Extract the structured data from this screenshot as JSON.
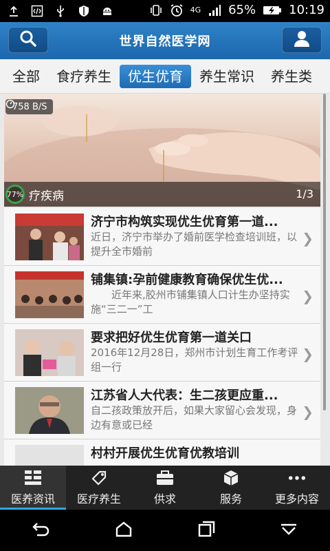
{
  "status_bar": {
    "battery_percent": "65%",
    "time": "10:19",
    "network": "4G"
  },
  "app": {
    "title": "世界自然医学网"
  },
  "tabs": [
    {
      "label": "全部"
    },
    {
      "label": "食疗养生"
    },
    {
      "label": "优生优育",
      "active": true
    },
    {
      "label": "养生常识"
    },
    {
      "label": "养生类"
    }
  ],
  "banner": {
    "speed": "758 B/S",
    "title": "疗疾病",
    "page": "1/3",
    "progress_label": "77%"
  },
  "articles": [
    {
      "title": "济宁市构筑实现优生优育第一道...",
      "desc": "近日，济宁市举办了婚前医学检查培训班，以提升全市婚前"
    },
    {
      "title": "铺集镇:孕前健康教育确保优生优...",
      "desc": "近年来,胶州市铺集镇人口计生办坚持实施“三二一”工"
    },
    {
      "title": "要求把好优生优育第一道关口",
      "desc": "2016年12月28日，郑州市计划生育工作考评组一行"
    },
    {
      "title": "江苏省人大代表：生二孩更应重...",
      "desc": "自二孩政策放开后，如果大家留心会发现，身边有意或已经"
    },
    {
      "title": "村村开展优生优育优教培训",
      "desc": ""
    }
  ],
  "bottom_nav": [
    {
      "label": "医养资讯",
      "icon": "grid-icon",
      "active": true
    },
    {
      "label": "医疗养生",
      "icon": "tag-icon"
    },
    {
      "label": "供求",
      "icon": "briefcase-icon"
    },
    {
      "label": "服务",
      "icon": "cube-icon"
    },
    {
      "label": "更多内容",
      "icon": "more-dots-icon"
    }
  ],
  "colors": {
    "header_blue": "#1c67ad",
    "active_tab_blue": "#1d6bb4",
    "nav_underline": "#35a8e0"
  }
}
